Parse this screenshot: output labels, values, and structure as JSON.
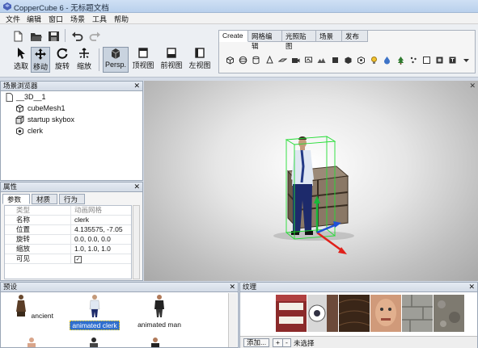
{
  "window": {
    "title": "CopperCube 6 - 无标题文档"
  },
  "menu": [
    "文件",
    "编辑",
    "窗口",
    "场景",
    "工具",
    "帮助"
  ],
  "toolbar": {
    "tools": [
      {
        "label": "选取",
        "icon": "cursor-arrow-icon"
      },
      {
        "label": "移动",
        "icon": "move-arrows-icon"
      },
      {
        "label": "旋转",
        "icon": "rotate-icon"
      },
      {
        "label": "缩放",
        "icon": "scale-icon"
      }
    ],
    "views": [
      {
        "label": "Persp.",
        "icon": "perspective-view-icon"
      },
      {
        "label": "顶视图",
        "icon": "top-view-icon"
      },
      {
        "label": "前视图",
        "icon": "front-view-icon"
      },
      {
        "label": "左视图",
        "icon": "left-view-icon"
      }
    ]
  },
  "create_panel": {
    "tabs": [
      "Create",
      "网格编辑",
      "光照贴图",
      "场景",
      "发布"
    ],
    "active_tab": "Create",
    "icons": [
      "cube-icon",
      "sphere-icon",
      "cylinder-icon",
      "cone-icon",
      "plane-icon",
      "camera-icon",
      "billboard-icon",
      "terrain-icon",
      "box-icon",
      "skybox-icon",
      "mesh-icon",
      "light-icon",
      "water-icon",
      "tree-icon",
      "particle-icon",
      "text-icon",
      "hud-image-icon",
      "hud-text-icon",
      "more-icon"
    ]
  },
  "scene_browser": {
    "title": "场景浏览器",
    "items": [
      {
        "label": "__3D__1",
        "icon": "page-icon",
        "indent": 0
      },
      {
        "label": "cubeMesh1",
        "icon": "mesh-node-icon",
        "indent": 1
      },
      {
        "label": "startup skybox",
        "icon": "skybox-node-icon",
        "indent": 1
      },
      {
        "label": "clerk",
        "icon": "animated-mesh-icon",
        "indent": 1
      }
    ]
  },
  "properties": {
    "title": "属性",
    "tabs": [
      "参数",
      "材质",
      "行为"
    ],
    "active_tab": "参数",
    "rows": [
      {
        "key": "类型",
        "value": "动画网格",
        "header": true
      },
      {
        "key": "名称",
        "value": "clerk"
      },
      {
        "key": "位置",
        "value": "4.135575, -7.05"
      },
      {
        "key": "旋转",
        "value": "0.0, 0.0, 0.0"
      },
      {
        "key": "缩放",
        "value": "1.0, 1.0, 1.0"
      },
      {
        "key": "可见",
        "value": "✓"
      }
    ]
  },
  "presets": {
    "title": "预设",
    "items": [
      {
        "label": "ancient",
        "selected": false
      },
      {
        "label": "animated clerk",
        "selected": true
      },
      {
        "label": "animated man",
        "selected": false
      }
    ]
  },
  "textures": {
    "title": "纹理",
    "add_label": "添加...",
    "plus_label": "+",
    "minus_label": "-",
    "status": "未选择"
  },
  "colors": {
    "selection_box": "#22dd33",
    "axis_x": "#e0201a",
    "axis_y": "#18b83a",
    "axis_z": "#1f4fd6",
    "accent": "#2f6fcf"
  }
}
